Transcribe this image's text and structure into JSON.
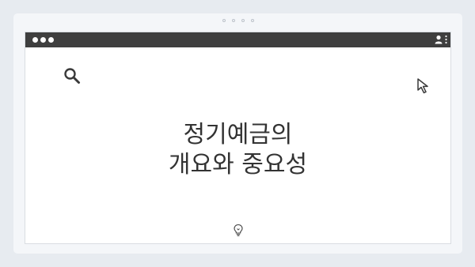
{
  "frame": {
    "background": "#e7ebf0",
    "card_color": "#f4f6f9",
    "pager_dot_count": 4
  },
  "window": {
    "titlebar_color": "#3f3f3f",
    "traffic_light_count": 3,
    "titlebar_icons": [
      "user-icon",
      "menu-dots-icon"
    ]
  },
  "content": {
    "headline_line1": "정기예금의",
    "headline_line2": "개요와 중요성",
    "text_color": "#333333",
    "decorations": [
      "search-icon",
      "cursor-icon",
      "lightbulb-icon"
    ]
  }
}
